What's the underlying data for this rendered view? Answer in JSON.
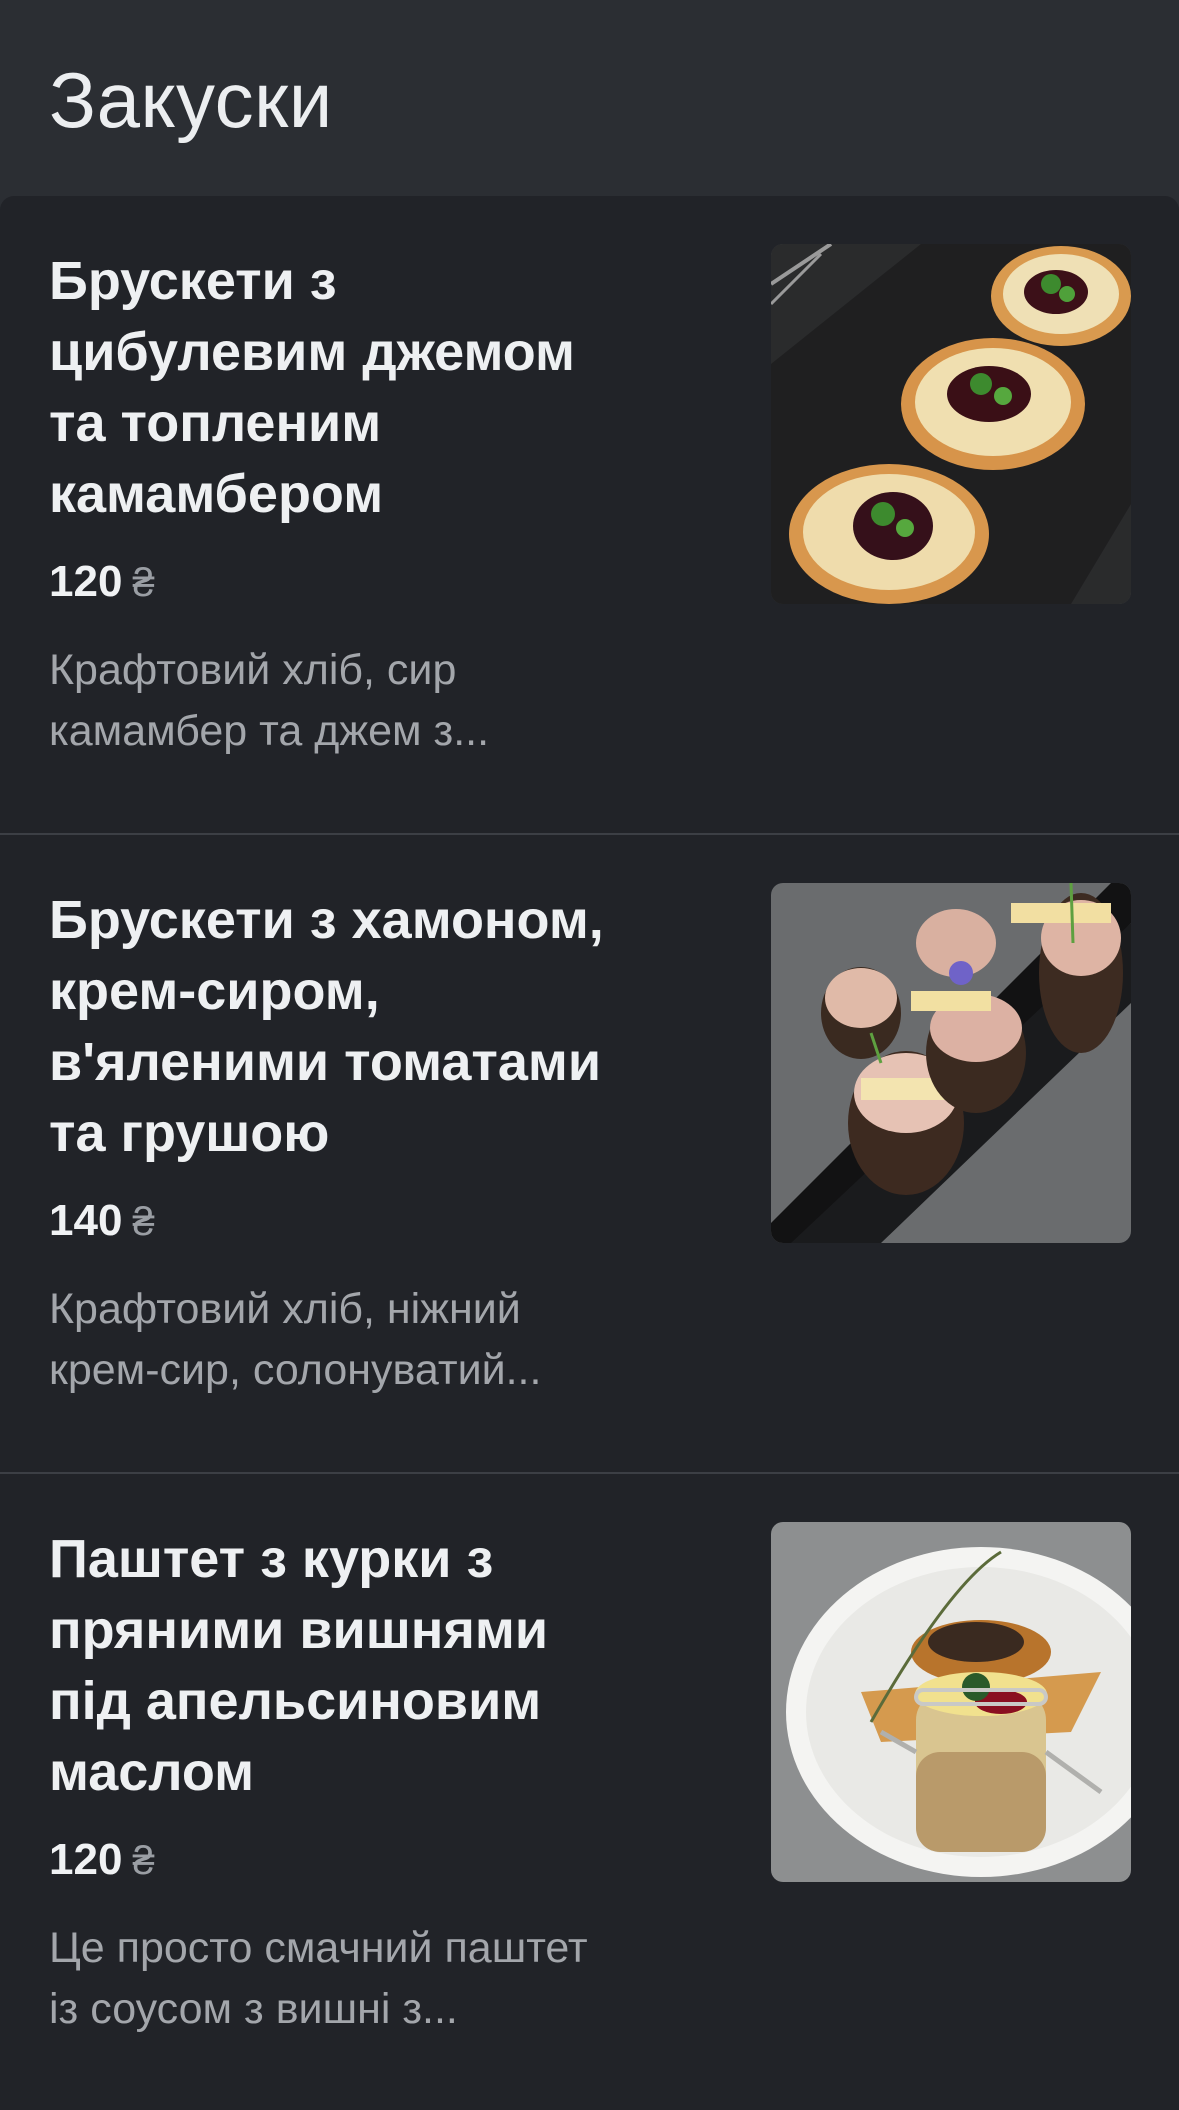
{
  "section": {
    "title": "Закуски"
  },
  "items": [
    {
      "title_lines": [
        "Брускети з",
        "цибулевим джемом",
        "та топленим",
        "камамбером"
      ],
      "price": "120",
      "currency": "₴",
      "description_lines": [
        "Крафтовий хліб, сир",
        "камамбер та джем з..."
      ],
      "image": "bruschetta-onion-jam-camembert-photo"
    },
    {
      "title_lines": [
        "Брускети з хамоном,",
        "крем-сиром,",
        "в'яленими томатами",
        "та грушою"
      ],
      "price": "140",
      "currency": "₴",
      "description_lines": [
        "Крафтовий хліб, ніжний",
        "крем-сир, солонуватий..."
      ],
      "image": "bruschetta-jamon-photo"
    },
    {
      "title_lines": [
        "Паштет з курки з",
        "пряними вишнями",
        "під апельсиновим",
        "маслом"
      ],
      "price": "120",
      "currency": "₴",
      "description_lines": [
        "Це просто смачний паштет",
        "із соусом з вишні з..."
      ],
      "image": "chicken-pate-jar-photo"
    }
  ],
  "colors": {
    "header_bg": "#2b2e33",
    "list_bg": "#212328",
    "text_primary": "#eef0f2",
    "text_secondary": "#a3a6ab"
  }
}
